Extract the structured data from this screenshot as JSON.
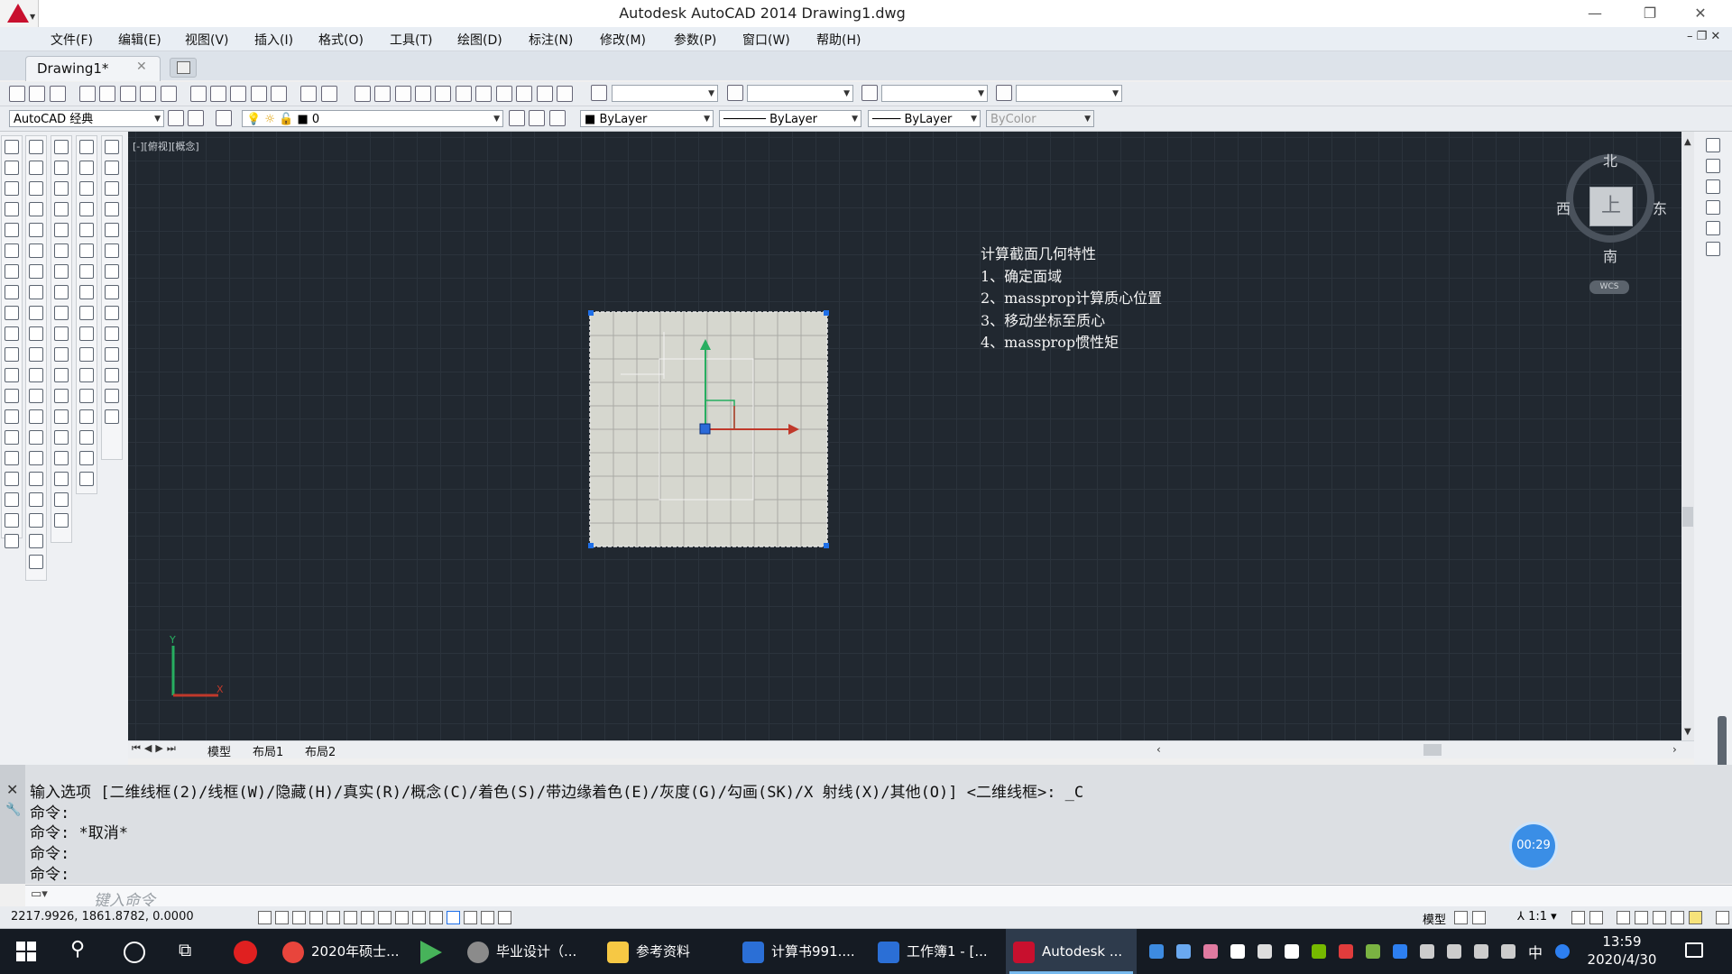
{
  "window": {
    "title": "Autodesk AutoCAD 2014    Drawing1.dwg",
    "minimize": "—",
    "restore": "❐",
    "close": "✕"
  },
  "menu": [
    "文件(F)",
    "编辑(E)",
    "视图(V)",
    "插入(I)",
    "格式(O)",
    "工具(T)",
    "绘图(D)",
    "标注(N)",
    "修改(M)",
    "参数(P)",
    "窗口(W)",
    "帮助(H)"
  ],
  "doc_tab": {
    "label": "Drawing1*",
    "close": "✕"
  },
  "toolbar": {
    "workspace": "AutoCAD 经典",
    "layer": "0",
    "color": "ByLayer",
    "linetype": "ByLayer",
    "lineweight": "ByLayer",
    "plotstyle": "ByColor"
  },
  "viewport_label": "[-][俯视][概念]",
  "notes": {
    "title": "计算截面几何特性",
    "steps": [
      "1、确定面域",
      "2、massprop计算质心位置",
      "3、移动坐标至质心",
      "4、massprop惯性矩"
    ]
  },
  "viewcube": {
    "north": "北",
    "south": "南",
    "east": "东",
    "west": "西",
    "face": "上",
    "wcs": "WCS"
  },
  "ucs": {
    "x": "X",
    "y": "Y"
  },
  "layout_tabs": [
    "模型",
    "布局1",
    "布局2"
  ],
  "command_history": [
    "输入选项 [二维线框(2)/线框(W)/隐藏(H)/真实(R)/概念(C)/着色(S)/带边缘着色(E)/灰度(G)/勾画(SK)/X 射线(X)/其他(O)] <二维线框>: _C",
    "命令:",
    "命令: *取消*",
    "命令:",
    "命令:"
  ],
  "command_placeholder": "键入命令",
  "timer": "00:29",
  "status": {
    "coords": "2217.9926, 1861.8782, 0.0000",
    "model": "模型",
    "scale": "1:1"
  },
  "taskbar": {
    "apps": [
      {
        "label": "2020年硕士...",
        "color": "#e8453c"
      },
      {
        "label": "毕业设计（...",
        "color": "#8b8b8b"
      },
      {
        "label": "参考资料",
        "color": "#f6c844"
      },
      {
        "label": "计算书991....",
        "color": "#2b6fd6"
      },
      {
        "label": "工作簿1 - [...",
        "color": "#2b6fd6"
      },
      {
        "label": "Autodesk ...",
        "color": "#c8102e"
      }
    ],
    "ime": "中",
    "time": "13:59",
    "date": "2020/4/30"
  },
  "colors": {
    "canvas": "#212830",
    "grip": "#1e6fe8",
    "region_fill": "#d6d7cf",
    "axis_x": "#c0392b",
    "axis_y": "#27ae60",
    "accent": "#c8102e"
  }
}
